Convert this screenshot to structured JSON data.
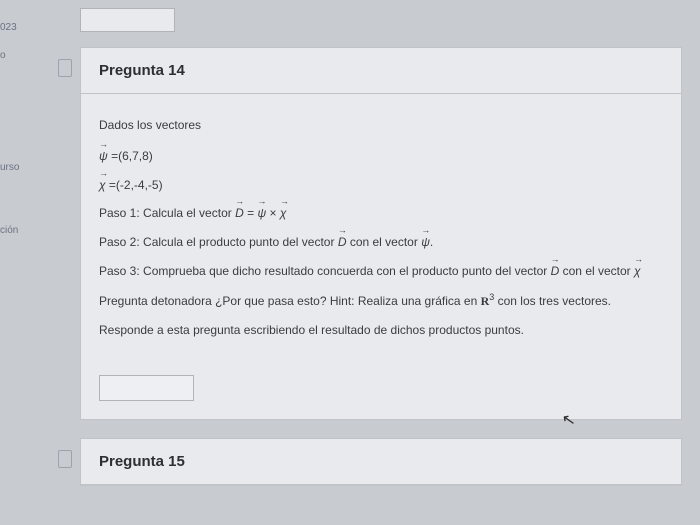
{
  "sidebar": {
    "t1": "023",
    "t2": "o",
    "t3": "urso",
    "t4": "ción"
  },
  "q14": {
    "title": "Pregunta 14",
    "intro": "Dados los vectores",
    "psi": "ψ =(6,7,8)",
    "chi": "χ =(-2,-4,-5)",
    "step1_a": "Paso 1: Calcula el vector ",
    "step1_b": " = ",
    "step1_c": " × ",
    "step2_a": "Paso 2: Calcula el producto punto del vector ",
    "step2_b": " con el vector ",
    "step2_c": ".",
    "step3_a": "Paso 3: Comprueba que dicho resultado concuerda con el producto punto del vector ",
    "step3_b": " con el vector ",
    "hint_a": "Pregunta detonadora ¿Por que pasa esto? Hint: Realiza una gráfica en ",
    "hint_b": " con los tres vectores.",
    "respond": "Responde a esta pregunta escribiendo el resultado de dichos productos puntos."
  },
  "q15": {
    "title": "Pregunta 15"
  },
  "sym": {
    "D": "D",
    "psi": "ψ",
    "chi": "χ",
    "R3a": "R",
    "R3b": "3"
  }
}
